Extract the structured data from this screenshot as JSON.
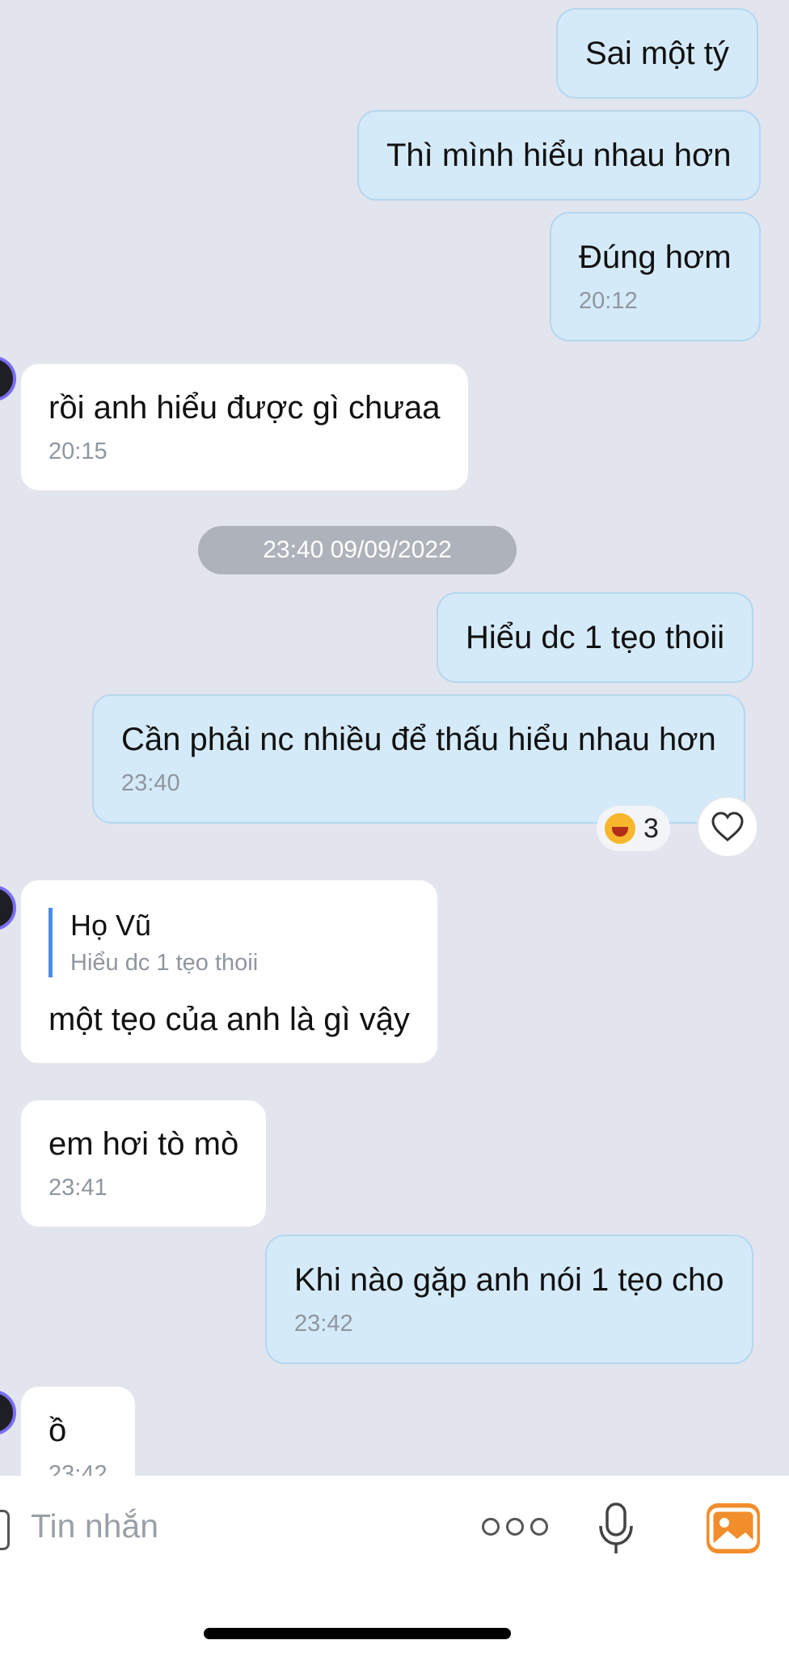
{
  "messages": [
    {
      "id": "m1",
      "dir": "sent",
      "text": "Sai một tý"
    },
    {
      "id": "m2",
      "dir": "sent",
      "text": "Thì mình hiểu nhau hơn"
    },
    {
      "id": "m3",
      "dir": "sent",
      "text": "Đúng hơm",
      "time": "20:12"
    },
    {
      "id": "m4",
      "dir": "recv",
      "text": "rồi anh hiểu được gì chưaa",
      "time": "20:15"
    },
    {
      "id": "m5",
      "dir": "sent",
      "text": "Hiểu dc 1 tẹo thoii"
    },
    {
      "id": "m6",
      "dir": "sent",
      "text": "Cần phải nc nhiều để thấu hiểu nhau hơn",
      "time": "23:40"
    },
    {
      "id": "m7",
      "dir": "recv",
      "quote_name": "Họ Vũ",
      "quote_text": "Hiểu dc 1 tẹo thoii",
      "text": "một tẹo của anh là gì vậy"
    },
    {
      "id": "m8",
      "dir": "recv",
      "text": "em hơi tò mò",
      "time": "23:41"
    },
    {
      "id": "m9",
      "dir": "sent",
      "text": "Khi nào gặp anh nói 1 tẹo cho",
      "time": "23:42"
    },
    {
      "id": "m10",
      "dir": "recv",
      "text": "ồ",
      "time": "23:42"
    }
  ],
  "date_divider": "23:40 09/09/2022",
  "reaction": {
    "emoji_icon": "laughing-face-icon",
    "count": "3"
  },
  "composer": {
    "placeholder": "Tin nhắn"
  },
  "colors": {
    "sent_bubble": "#d5eaf9",
    "recv_bubble": "#ffffff",
    "background": "#e2e5ee",
    "accent": "#f28d2c",
    "quote_bar": "#4a8de6"
  }
}
